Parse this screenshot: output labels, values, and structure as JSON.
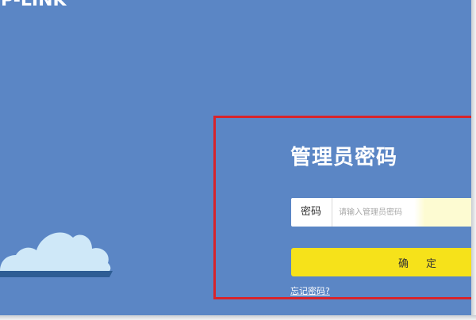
{
  "brand": {
    "logo_text": "TP-LINK",
    "logo_icon": "tp-link-logo"
  },
  "colors": {
    "background": "#5b86c5",
    "highlight_border": "#d7242b",
    "button": "#f6e21a",
    "cloud_light": "#cfe8f8",
    "cloud_shadow": "#2e5d94"
  },
  "decor": {
    "cloud_icon": "cloud-icon"
  },
  "login": {
    "title": "管理员密码",
    "password_label": "密码",
    "password_placeholder": "请输入管理员密码",
    "password_value": "",
    "confirm_label": "确定",
    "forgot_link": "忘记密码?"
  }
}
